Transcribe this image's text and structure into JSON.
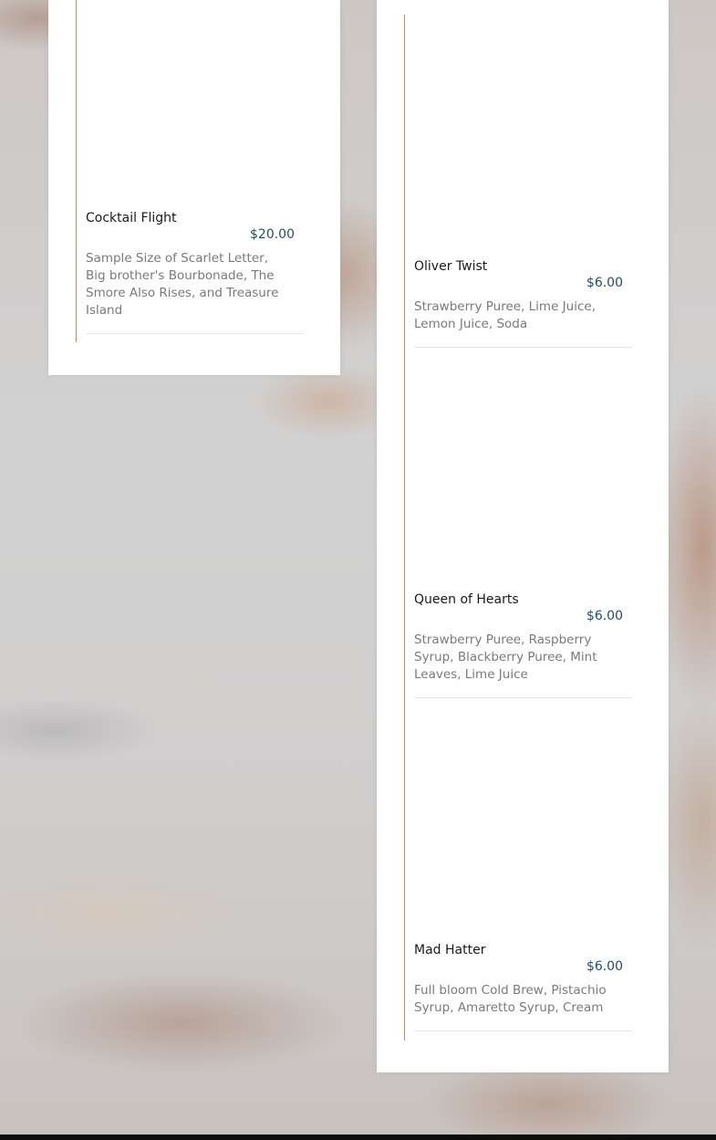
{
  "menu": {
    "left_column": [
      {
        "name": "Cocktail Flight",
        "price": "$20.00",
        "description": "Sample Size of Scarlet Letter, Big brother's Bourbonade, The Smore Also Rises, and Treasure Island"
      }
    ],
    "right_column": [
      {
        "name": "Oliver Twist",
        "price": "$6.00",
        "description": "Strawberry Puree, Lime Juice, Lemon Juice, Soda"
      },
      {
        "name": "Queen of Hearts",
        "price": "$6.00",
        "description": "Strawberry Puree, Raspberry Syrup, Blackberry Puree, Mint Leaves, Lime Juice"
      },
      {
        "name": "Mad Hatter",
        "price": "$6.00",
        "description": "Full bloom Cold Brew, Pistachio Syrup, Amaretto Syrup, Cream"
      }
    ]
  },
  "colors": {
    "accent_rule": "#c98a4e",
    "price": "#1f4e6e"
  }
}
